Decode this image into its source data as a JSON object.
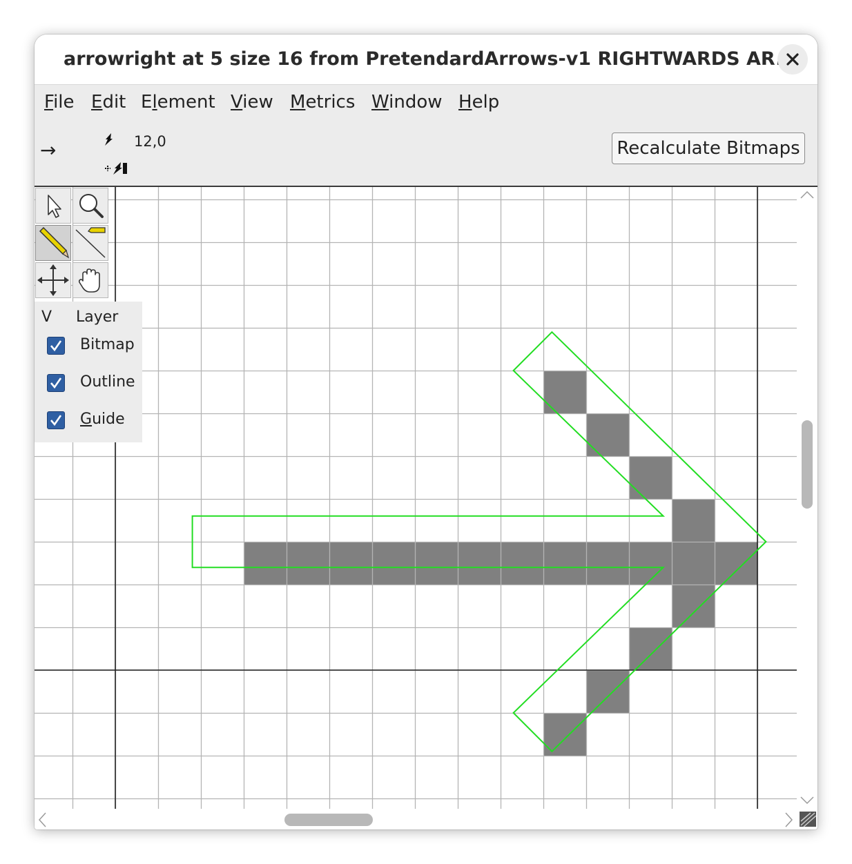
{
  "window": {
    "title": "arrowright at 5 size 16 from PretendardArrows-v1 RIGHTWARDS AR..."
  },
  "menu": [
    {
      "label": "File",
      "u": "F",
      "rest": "ile"
    },
    {
      "label": "Edit",
      "u": "E",
      "rest": "dit"
    },
    {
      "label": "Element",
      "pre": "E",
      "u": "l",
      "rest": "ement"
    },
    {
      "label": "View",
      "u": "V",
      "rest": "iew"
    },
    {
      "label": "Metrics",
      "u": "M",
      "rest": "etrics"
    },
    {
      "label": "Window",
      "u": "W",
      "rest": "indow"
    },
    {
      "label": "Help",
      "u": "H",
      "rest": "elp"
    }
  ],
  "toolbar": {
    "glyph": "→",
    "coords": "12,0",
    "recalc_label": "Recalculate Bitmaps"
  },
  "tools": [
    {
      "name": "pointer-tool-button",
      "icon": "arrow-pointer-icon",
      "active": false
    },
    {
      "name": "magnify-tool-button",
      "icon": "magnifier-icon",
      "active": false
    },
    {
      "name": "pencil-tool-button",
      "icon": "pencil-icon",
      "active": true
    },
    {
      "name": "line-tool-button",
      "icon": "line-icon",
      "active": false
    },
    {
      "name": "shift-tool-button",
      "icon": "move-arrows-icon",
      "active": false
    },
    {
      "name": "scroll-tool-button",
      "icon": "hand-icon",
      "active": false
    }
  ],
  "layers": {
    "col_visible": "V",
    "col_layer": "Layer",
    "items": [
      {
        "label": "Bitmap",
        "checked": true
      },
      {
        "label": "Outline",
        "checked": true
      },
      {
        "label": "Guide",
        "u": "G",
        "rest": "uide",
        "checked": true
      }
    ]
  },
  "bitmap": {
    "filled_cells": [
      [
        10,
        2
      ],
      [
        11,
        3
      ],
      [
        12,
        4
      ],
      [
        13,
        5
      ],
      [
        3,
        6
      ],
      [
        4,
        6
      ],
      [
        5,
        6
      ],
      [
        6,
        6
      ],
      [
        7,
        6
      ],
      [
        8,
        6
      ],
      [
        9,
        6
      ],
      [
        10,
        6
      ],
      [
        11,
        6
      ],
      [
        12,
        6
      ],
      [
        13,
        6
      ],
      [
        14,
        6
      ],
      [
        13,
        7
      ],
      [
        12,
        8
      ],
      [
        11,
        9
      ],
      [
        10,
        10
      ]
    ],
    "pixel_color": "#808080",
    "outline_color": "#22dd22",
    "grid_color": "#b4b4b4",
    "axis_color": "#222222"
  }
}
